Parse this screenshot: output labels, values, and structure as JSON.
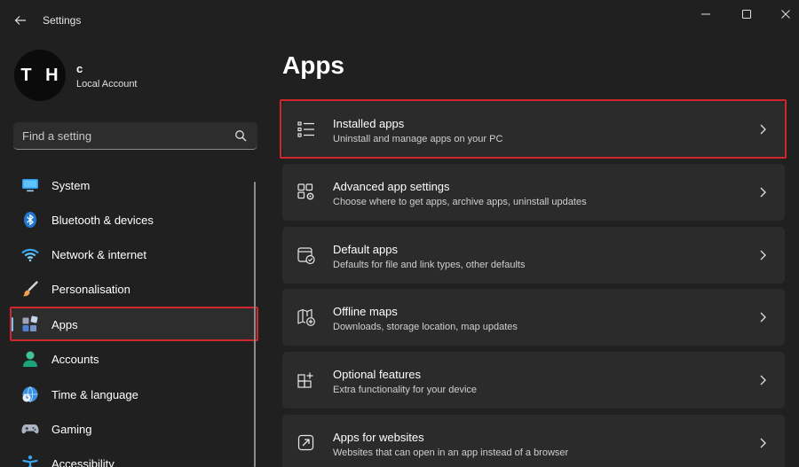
{
  "window": {
    "title": "Settings",
    "icons": {
      "back": "back-arrow-icon",
      "minimize": "minimize-icon",
      "maximize": "maximize-icon",
      "close": "close-icon"
    }
  },
  "profile": {
    "initials": "T H",
    "name": "c",
    "account_type": "Local Account"
  },
  "search": {
    "placeholder": "Find a setting",
    "icon": "search-icon"
  },
  "sidebar": {
    "items": [
      {
        "label": "System",
        "icon": "system-icon",
        "active": false
      },
      {
        "label": "Bluetooth & devices",
        "icon": "bluetooth-icon",
        "active": false
      },
      {
        "label": "Network & internet",
        "icon": "wifi-icon",
        "active": false
      },
      {
        "label": "Personalisation",
        "icon": "paintbrush-icon",
        "active": false
      },
      {
        "label": "Apps",
        "icon": "apps-icon",
        "active": true
      },
      {
        "label": "Accounts",
        "icon": "accounts-icon",
        "active": false
      },
      {
        "label": "Time & language",
        "icon": "globe-clock-icon",
        "active": false
      },
      {
        "label": "Gaming",
        "icon": "gamepad-icon",
        "active": false
      },
      {
        "label": "Accessibility",
        "icon": "accessibility-icon",
        "active": false
      }
    ]
  },
  "main": {
    "title": "Apps",
    "cards": [
      {
        "title": "Installed apps",
        "description": "Uninstall and manage apps on your PC",
        "icon": "list-icon"
      },
      {
        "title": "Advanced app settings",
        "description": "Choose where to get apps, archive apps, uninstall updates",
        "icon": "app-settings-icon"
      },
      {
        "title": "Default apps",
        "description": "Defaults for file and link types, other defaults",
        "icon": "default-apps-icon"
      },
      {
        "title": "Offline maps",
        "description": "Downloads, storage location, map updates",
        "icon": "map-icon"
      },
      {
        "title": "Optional features",
        "description": "Extra functionality for your device",
        "icon": "optional-features-icon"
      },
      {
        "title": "Apps for websites",
        "description": "Websites that can open in an app instead of a browser",
        "icon": "open-external-icon"
      }
    ]
  },
  "colors": {
    "background": "#202020",
    "card": "#2b2b2b",
    "accent": "#60cdff",
    "highlight": "#d0262e"
  }
}
